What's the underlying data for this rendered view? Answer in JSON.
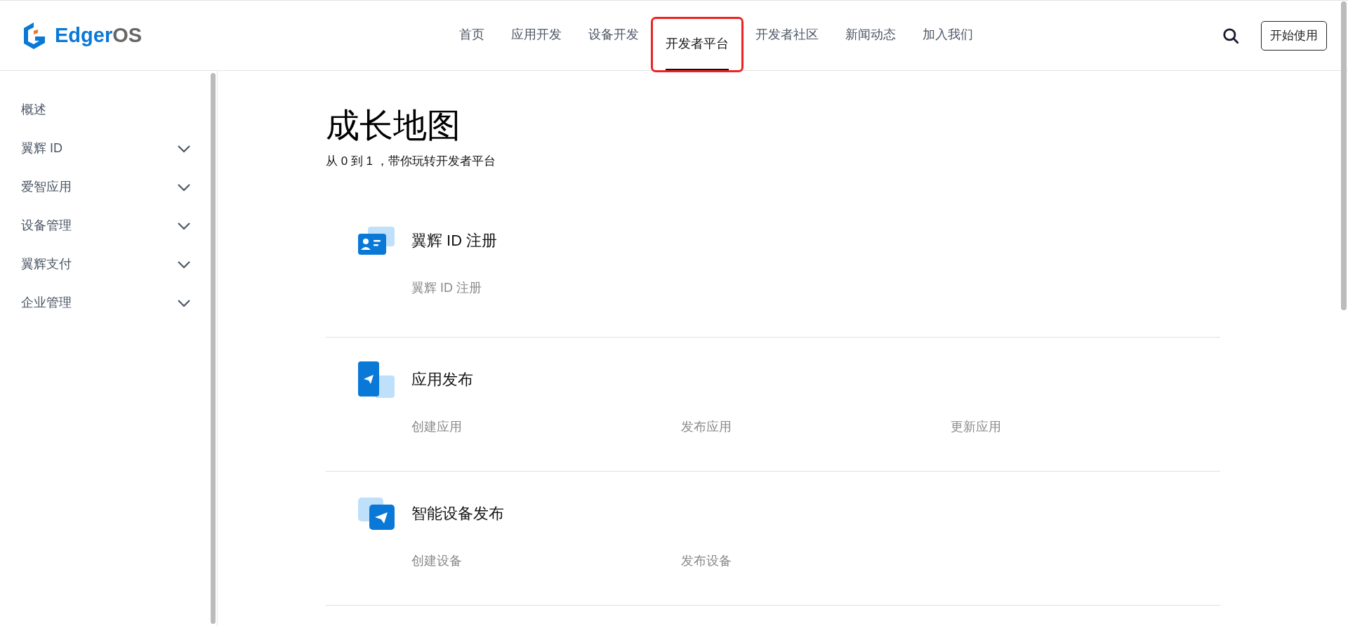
{
  "logo": {
    "brand": "Edger",
    "suffix": "OS"
  },
  "nav": [
    {
      "label": "首页",
      "selected": false,
      "highlighted": false
    },
    {
      "label": "应用开发",
      "selected": false,
      "highlighted": false
    },
    {
      "label": "设备开发",
      "selected": false,
      "highlighted": false
    },
    {
      "label": "开发者平台",
      "selected": true,
      "highlighted": true
    },
    {
      "label": "开发者社区",
      "selected": false,
      "highlighted": false
    },
    {
      "label": "新闻动态",
      "selected": false,
      "highlighted": false
    },
    {
      "label": "加入我们",
      "selected": false,
      "highlighted": false
    }
  ],
  "start_button": "开始使用",
  "sidebar": {
    "items": [
      {
        "label": "概述",
        "expandable": false
      },
      {
        "label": "翼辉 ID",
        "expandable": true
      },
      {
        "label": "爱智应用",
        "expandable": true
      },
      {
        "label": "设备管理",
        "expandable": true
      },
      {
        "label": "翼辉支付",
        "expandable": true
      },
      {
        "label": "企业管理",
        "expandable": true
      }
    ]
  },
  "page": {
    "title": "成长地图",
    "subtitle": "从 0 到 1 ，带你玩转开发者平台"
  },
  "sections": [
    {
      "kind": "id-card",
      "title": "翼辉 ID 注册",
      "links": [
        "翼辉 ID 注册"
      ]
    },
    {
      "kind": "app",
      "title": "应用发布",
      "links": [
        "创建应用",
        "发布应用",
        "更新应用"
      ]
    },
    {
      "kind": "device",
      "title": "智能设备发布",
      "links": [
        "创建设备",
        "发布设备"
      ]
    }
  ]
}
